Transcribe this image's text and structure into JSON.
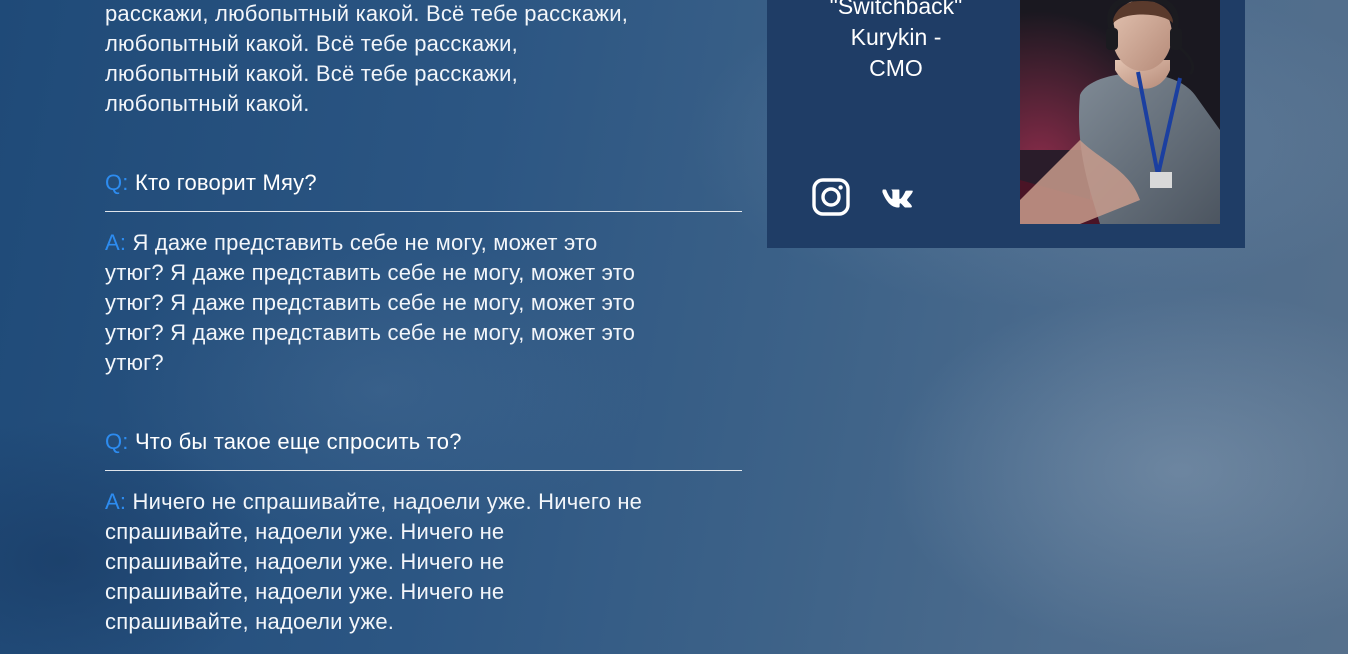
{
  "faq": {
    "top_answer": {
      "lines": [
        "расскажи, любопытный какой. Всё тебе расскажи,",
        "любопытный какой. Всё тебе расскажи,",
        "любопытный какой. Всё тебе расскажи,",
        "любопытный какой."
      ]
    },
    "items": [
      {
        "q_prefix": "Q:",
        "question": "Кто говорит Мяу?",
        "a_prefix": "A:",
        "answer_lines": [
          " Я даже представить себе не могу, может это",
          "утюг? Я даже представить себе не могу, может это",
          "утюг? Я даже представить себе не могу, может это",
          "утюг? Я даже представить себе не могу, может это",
          "утюг?"
        ]
      },
      {
        "q_prefix": "Q:",
        "question": "Что бы такое еще спросить то?",
        "a_prefix": "A:",
        "answer_lines": [
          " Ничего не спрашивайте, надоели уже. Ничего не",
          "спрашивайте, надоели уже. Ничего не",
          "спрашивайте, надоели уже. Ничего не",
          "спрашивайте, надоели уже. Ничего не",
          "спрашивайте, надоели уже."
        ]
      }
    ]
  },
  "team_card": {
    "name_lines": [
      "\"Switchback\"",
      "Kurykin -",
      "CMO"
    ],
    "social": [
      {
        "icon": "instagram-icon"
      },
      {
        "icon": "vk-icon"
      }
    ],
    "photo_icon": "team-member-photo"
  },
  "colors": {
    "accent": "#2d8cf0",
    "card_bg": "#1f3d66",
    "text": "#ffffff"
  }
}
